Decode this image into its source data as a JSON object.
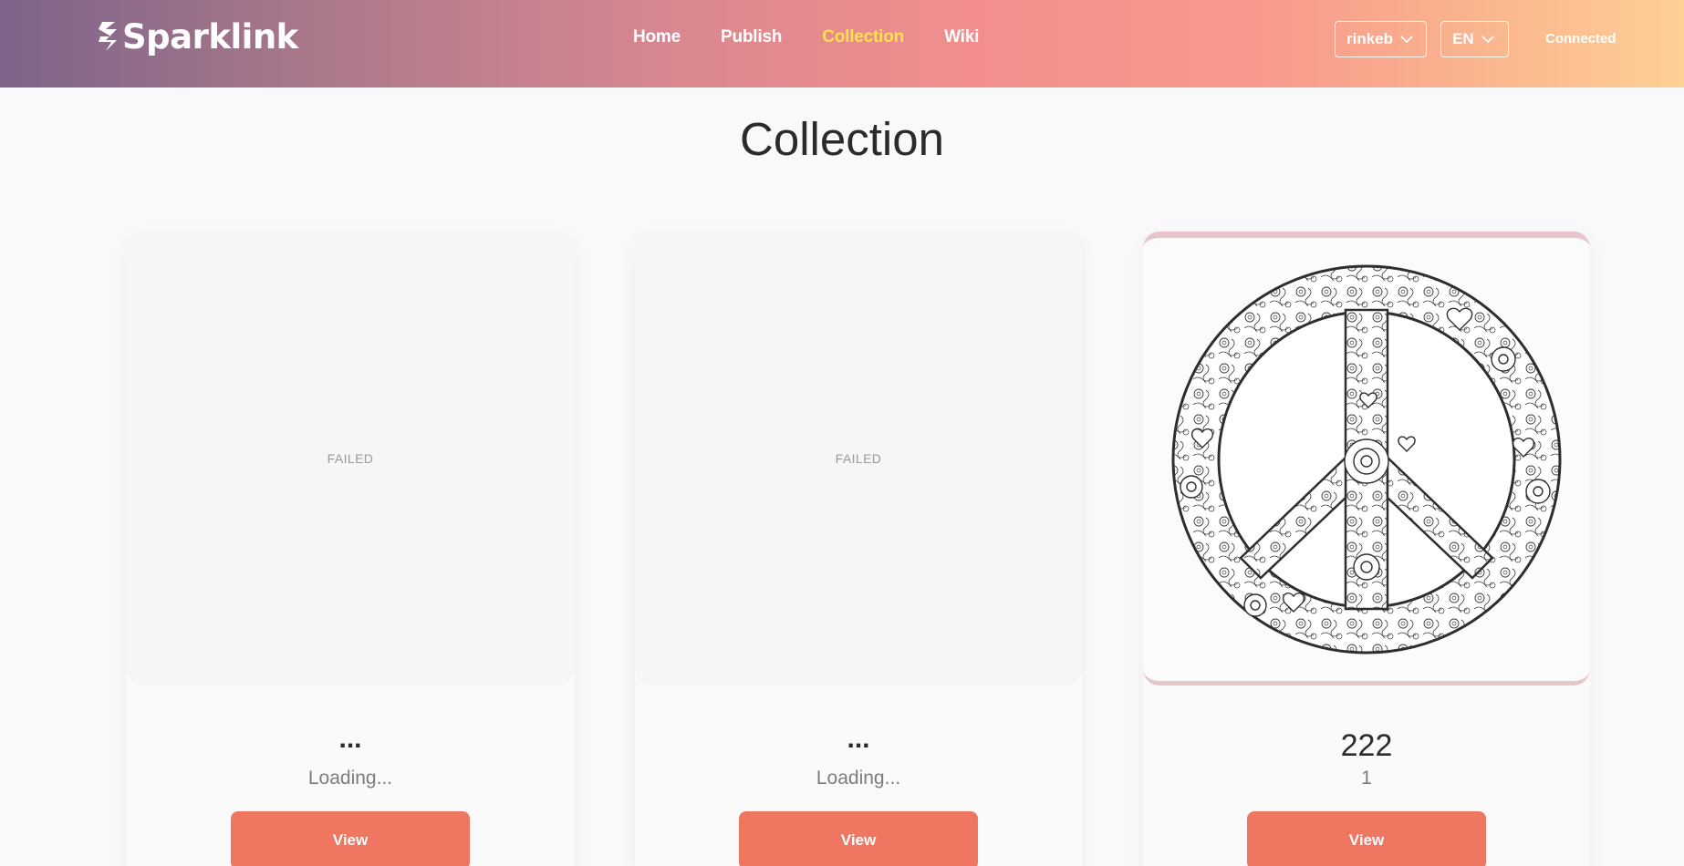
{
  "brand": {
    "name": "Sparklink"
  },
  "nav": {
    "items": [
      {
        "label": "Home",
        "active": false
      },
      {
        "label": "Publish",
        "active": false
      },
      {
        "label": "Collection",
        "active": true
      },
      {
        "label": "Wiki",
        "active": false
      }
    ]
  },
  "header": {
    "network_select": "rinkeb",
    "language_select": "EN",
    "wallet_status": "Connected"
  },
  "page": {
    "title": "Collection"
  },
  "cards": [
    {
      "media_status": "FAILED",
      "name": "...",
      "meta": "Loading...",
      "button": "View"
    },
    {
      "media_status": "FAILED",
      "name": "...",
      "meta": "Loading...",
      "button": "View"
    },
    {
      "media_status": "",
      "image": "peace-sign-mandala",
      "name": "222",
      "meta": "1",
      "button": "View"
    }
  ],
  "colors": {
    "accent": "#ef7762",
    "nav_active": "#ffe14d",
    "header_gradient_start": "#7d6489",
    "header_gradient_end": "#fdd094"
  }
}
